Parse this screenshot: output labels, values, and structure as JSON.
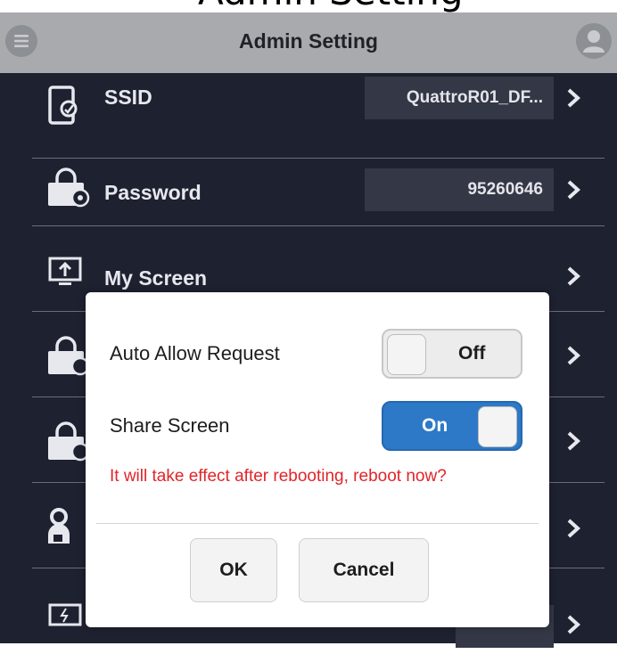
{
  "header": {
    "top_fragment": "Admin Setting",
    "title": "Admin Setting",
    "menu_icon": "menu-icon",
    "avatar_icon": "user-avatar-icon"
  },
  "settings": {
    "items": [
      {
        "label": "SSID",
        "value": "QuattroR01_DF...",
        "icon": "tablet-edit-icon"
      },
      {
        "label": "Password",
        "value": "95260646",
        "icon": "lock-settings-icon"
      },
      {
        "label": "My Screen",
        "value": "",
        "icon": "screen-upload-icon"
      },
      {
        "label": "",
        "value": "",
        "icon": "lock-settings-icon"
      },
      {
        "label": "",
        "value": "",
        "icon": "lock-settings-icon"
      },
      {
        "label": "",
        "value": "",
        "icon": "user-lock-icon"
      },
      {
        "label": "",
        "value": "",
        "icon": "screen-power-icon"
      }
    ],
    "chevron_icon": "chevron-right-icon"
  },
  "dialog": {
    "auto_allow_label": "Auto Allow Request",
    "auto_allow_state": "Off",
    "share_screen_label": "Share Screen",
    "share_screen_state": "On",
    "warning": "It will take effect after rebooting, reboot now?",
    "ok_label": "OK",
    "cancel_label": "Cancel"
  },
  "colors": {
    "header_bg": "#a8aaad",
    "list_bg": "#1e2130",
    "toggle_on": "#2d79c7",
    "warning_text": "#e0252a"
  }
}
